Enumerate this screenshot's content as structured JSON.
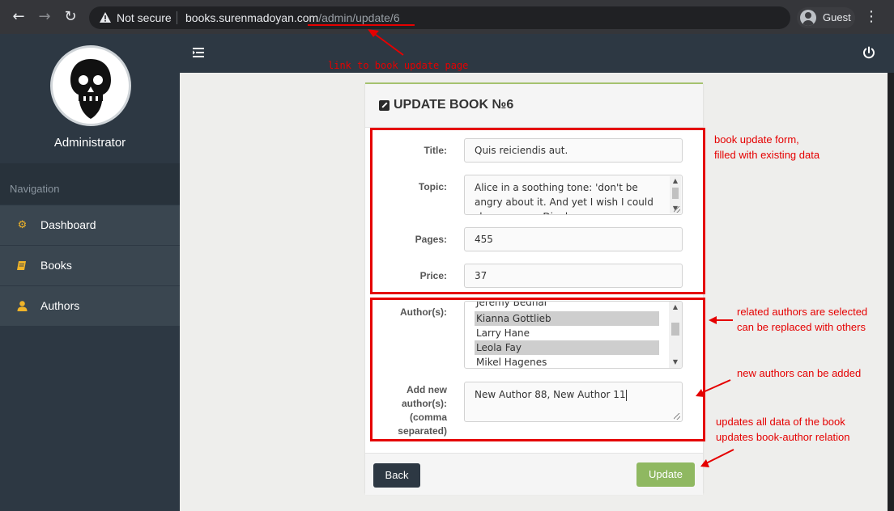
{
  "browser": {
    "security_label": "Not secure",
    "url_host": "books.surenmadoyan.com",
    "url_path": "/admin/update/6",
    "profile_label": "Guest"
  },
  "sidebar": {
    "user_name": "Administrator",
    "nav_heading": "Navigation",
    "items": [
      {
        "label": "Dashboard",
        "icon": "cogs-icon"
      },
      {
        "label": "Books",
        "icon": "book-icon"
      },
      {
        "label": "Authors",
        "icon": "user-icon"
      }
    ]
  },
  "panel": {
    "title": "UPDATE BOOK №6"
  },
  "form": {
    "title_label": "Title:",
    "title_value": "Quis reiciendis aut.",
    "topic_label": "Topic:",
    "topic_value": "Alice in a soothing tone: 'don't be angry about it. And yet I wish I could show you our Dinah",
    "pages_label": "Pages:",
    "pages_value": "455",
    "price_label": "Price:",
    "price_value": "37",
    "authors_label": "Author(s):",
    "authors_options": [
      {
        "name": "Jeremy Bednar",
        "selected": false
      },
      {
        "name": "Kianna Gottlieb",
        "selected": true
      },
      {
        "name": "Larry Hane",
        "selected": false
      },
      {
        "name": "Leola Fay",
        "selected": true
      },
      {
        "name": "Mikel Hagenes",
        "selected": false
      }
    ],
    "new_authors_label_1": "Add new",
    "new_authors_label_2": "author(s):",
    "new_authors_label_3": "(comma",
    "new_authors_label_4": "separated)",
    "new_authors_value": "New Author 88, New Author 11"
  },
  "actions": {
    "back_label": "Back",
    "update_label": "Update"
  },
  "annotations": {
    "link_note": "link to book update page",
    "form_note_1": "book update form,",
    "form_note_2": "filled with existing data",
    "authors_note_1": "related authors are selected",
    "authors_note_2": "can be replaced with others",
    "new_authors_note": "new authors can be added",
    "update_note_1": "updates all data of the book",
    "update_note_2": "updates book-author relation"
  },
  "colors": {
    "sidebar_bg": "#2d3843",
    "accent_green": "#8fb861",
    "annotation_red": "#e50000",
    "nav_icon": "#f0b429"
  }
}
